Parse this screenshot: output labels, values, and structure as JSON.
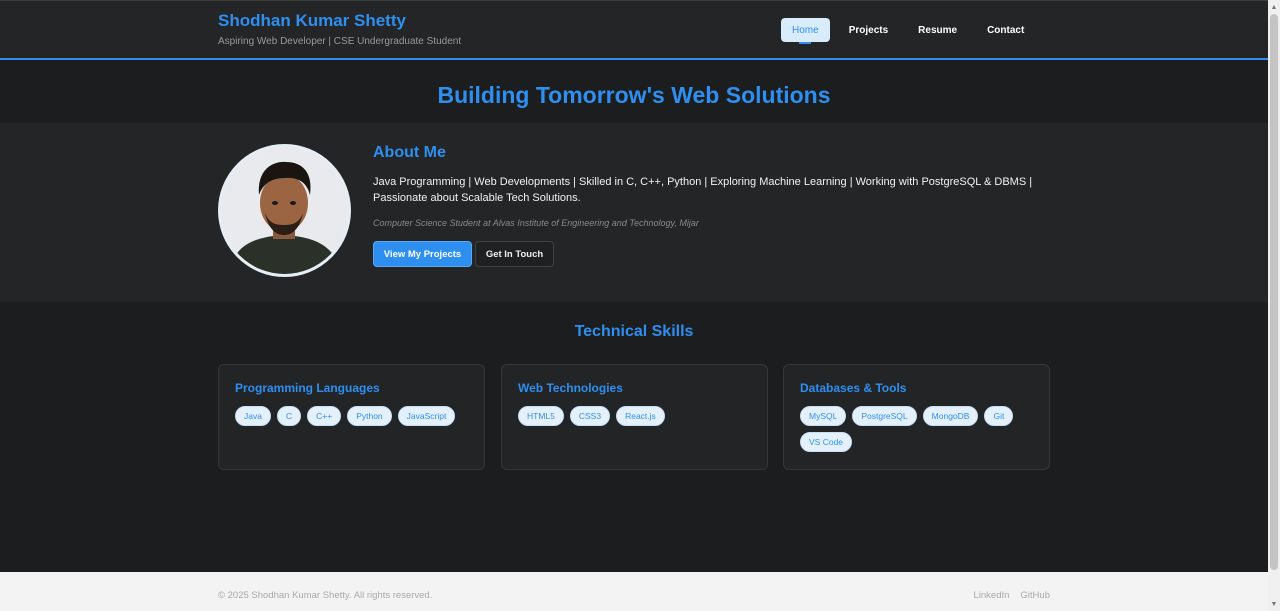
{
  "header": {
    "name": "Shodhan Kumar Shetty",
    "tagline": "Aspiring Web Developer | CSE Undergraduate Student",
    "nav": [
      {
        "label": "Home",
        "active": true
      },
      {
        "label": "Projects",
        "active": false
      },
      {
        "label": "Resume",
        "active": false
      },
      {
        "label": "Contact",
        "active": false
      }
    ]
  },
  "hero": {
    "title": "Building Tomorrow's Web Solutions"
  },
  "about": {
    "heading": "About Me",
    "text": "Java Programming | Web Developments | Skilled in C, C++, Python | Exploring Machine Learning | Working with PostgreSQL & DBMS | Passionate about Scalable Tech Solutions.",
    "subtext": "Computer Science Student at Alvas Institute of Engineering and Technology, Mijar",
    "primary_button": "View My Projects",
    "secondary_button": "Get In Touch"
  },
  "skills": {
    "title": "Technical Skills",
    "cards": [
      {
        "title": "Programming Languages",
        "items": [
          "Java",
          "C",
          "C++",
          "Python",
          "JavaScript"
        ]
      },
      {
        "title": "Web Technologies",
        "items": [
          "HTML5",
          "CSS3",
          "React.js"
        ]
      },
      {
        "title": "Databases & Tools",
        "items": [
          "MySQL",
          "PostgreSQL",
          "MongoDB",
          "Git",
          "VS Code"
        ]
      }
    ]
  },
  "footer": {
    "copyright": "© 2025 Shodhan Kumar Shetty. All rights reserved.",
    "links": [
      "LinkedIn",
      "GitHub"
    ]
  },
  "colors": {
    "accent": "#2e8ff0",
    "background": "#1c1d1e",
    "panel": "#232526"
  }
}
